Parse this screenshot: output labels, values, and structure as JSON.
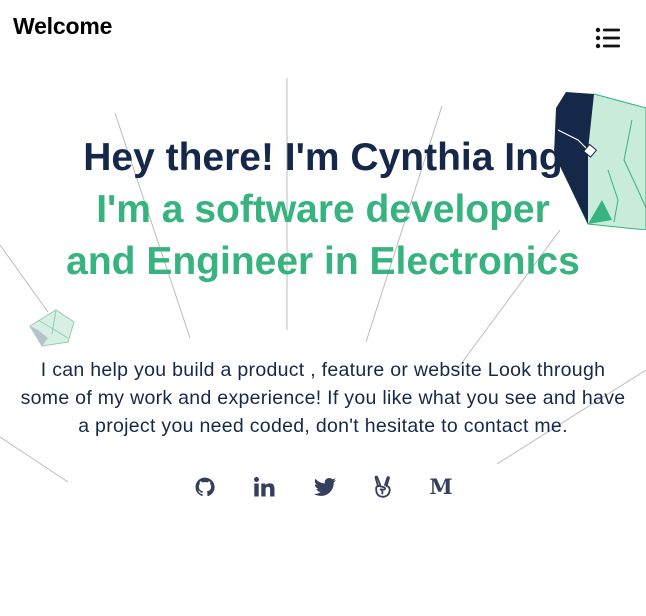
{
  "header": {
    "brand": "Welcome",
    "menu_icon": "list-menu-icon"
  },
  "hero": {
    "greeting": "Hey there! I'm Cynthia Ing",
    "role_line1": "I'm a software developer",
    "role_line2": "and Engineer in Electronics"
  },
  "intro": {
    "text": "I can help you build a product , feature or website Look through some of my work and experience! If you like what you see and have a project you need coded, don't hesitate to contact me."
  },
  "socials": [
    {
      "icon": "github-icon"
    },
    {
      "icon": "linkedin-icon"
    },
    {
      "icon": "twitter-icon"
    },
    {
      "icon": "angellist-icon"
    },
    {
      "icon": "medium-icon",
      "glyph": "M"
    }
  ],
  "colors": {
    "navy": "#162849",
    "green": "#36b37e",
    "icon": "#34405e",
    "mint": "#c9ebd9"
  }
}
